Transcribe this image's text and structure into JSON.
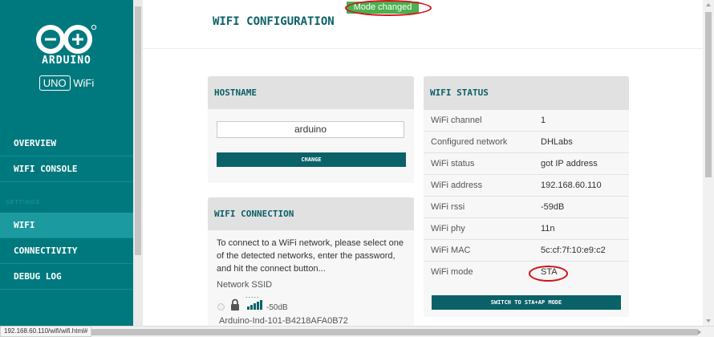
{
  "sidebar": {
    "brand": "ARDUINO",
    "model_badge": "UNO",
    "model_suffix": "WiFi",
    "section_label": "SETTINGS",
    "nav": [
      {
        "label": "OVERVIEW",
        "active": false
      },
      {
        "label": "WIFI CONSOLE",
        "active": false
      },
      {
        "label": "WIFI",
        "active": true
      },
      {
        "label": "CONNECTIVITY",
        "active": false
      },
      {
        "label": "DEBUG LOG",
        "active": false
      }
    ]
  },
  "main": {
    "title": "WIFI CONFIGURATION",
    "toast": "Mode changed"
  },
  "hostname": {
    "heading": "HOSTNAME",
    "value": "arduino",
    "button": "CHANGE"
  },
  "connection": {
    "heading": "WIFI CONNECTION",
    "intro": "To connect to a WiFi network, please select one of the detected networks, enter the password, and hit the connect button...",
    "ssid_label": "Network SSID",
    "loading_dots": ".....",
    "network": {
      "signal": "-50dB",
      "name": "Arduino-Ind-101-B4218AFA0B72"
    }
  },
  "status": {
    "heading": "WIFI STATUS",
    "rows": [
      {
        "key": "WiFi channel",
        "value": "1"
      },
      {
        "key": "Configured network",
        "value": "DHLabs"
      },
      {
        "key": "WiFi status",
        "value": "got IP address"
      },
      {
        "key": "WiFi address",
        "value": "192.168.60.110"
      },
      {
        "key": "WiFi rssi",
        "value": "-59dB"
      },
      {
        "key": "WiFi phy",
        "value": "11n"
      },
      {
        "key": "WiFi MAC",
        "value": "5c:cf:7f:10:e9:c2"
      },
      {
        "key": "WiFi mode",
        "value": "STA"
      }
    ],
    "button": "SWITCH TO STA+AP MODE"
  },
  "browser": {
    "status_url": "192.168.60.110/wifi/wifi.html#"
  },
  "colors": {
    "sidebar": "#00797e",
    "sidebar_active": "#1b9aa0",
    "accent": "#0b6168",
    "toast": "#4caf50",
    "highlight_ring": "#d4121a"
  }
}
